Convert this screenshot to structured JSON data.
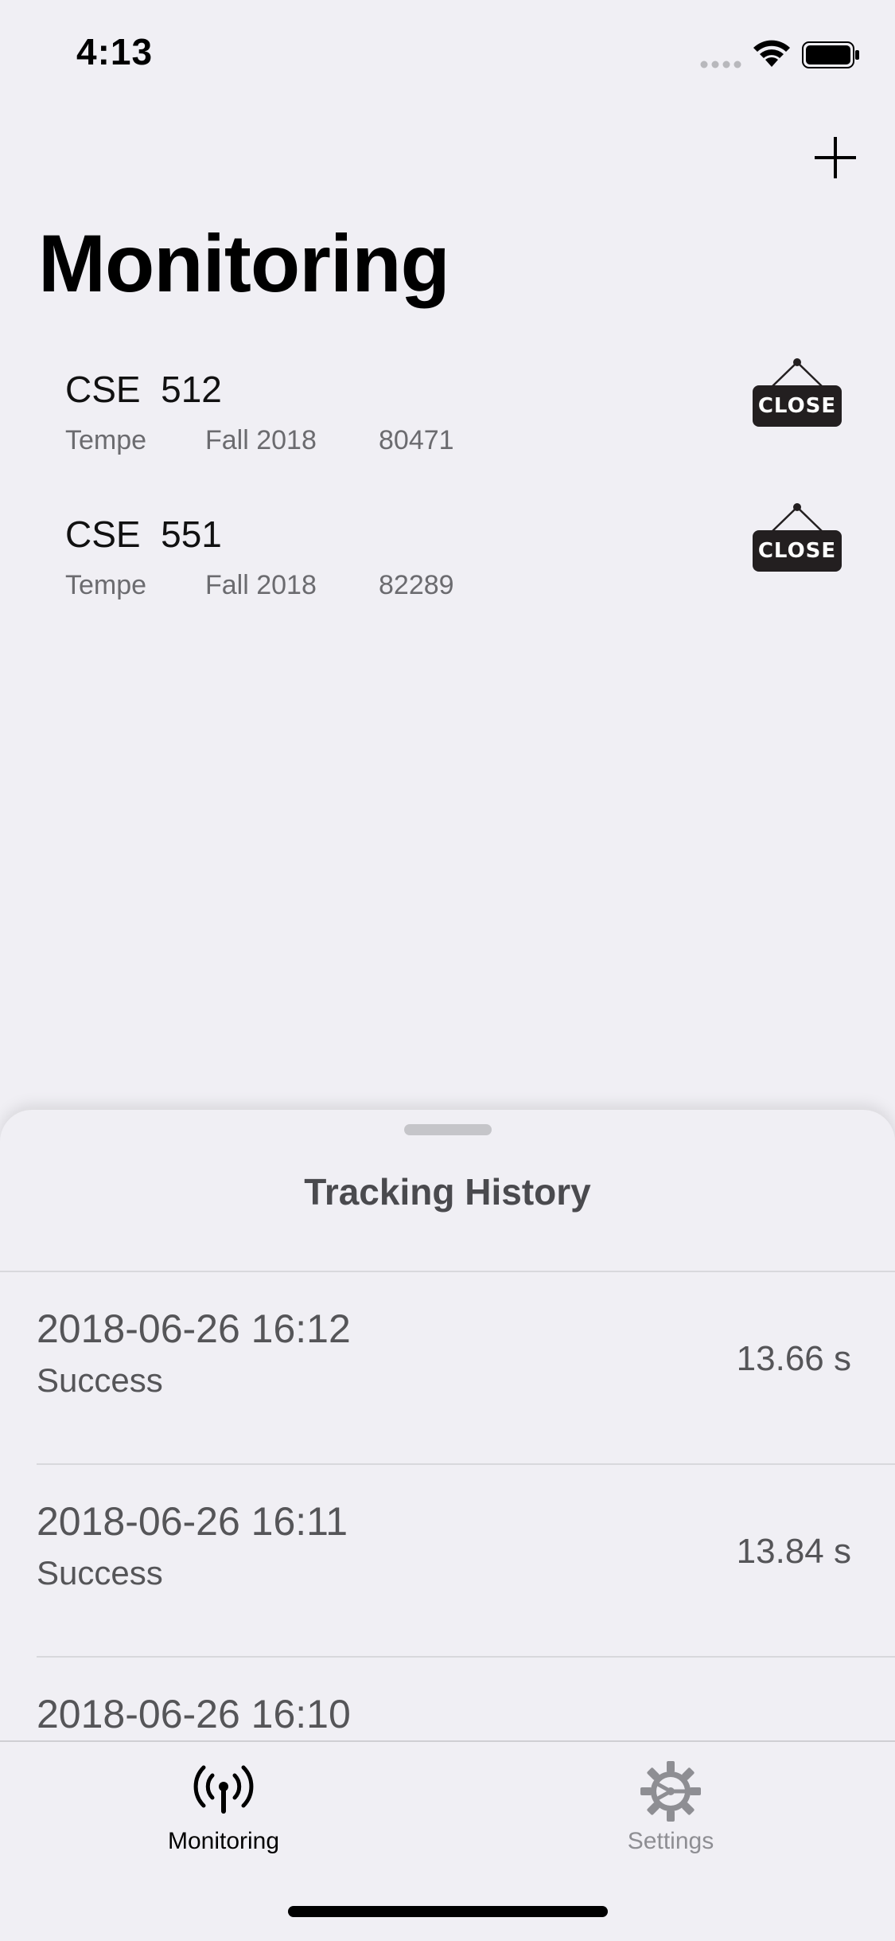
{
  "status_bar": {
    "time": "4:13",
    "signal_icon": "signal-bars-icon",
    "wifi_icon": "wifi-icon",
    "battery_icon": "battery-icon"
  },
  "nav": {
    "add_icon": "plus-icon",
    "title": "Monitoring"
  },
  "courses": [
    {
      "name": "CSE  512",
      "campus": "Tempe",
      "term": "Fall 2018",
      "class_number": "80471",
      "status_icon": "close-sign-icon",
      "status_text": "CLOSE"
    },
    {
      "name": "CSE  551",
      "campus": "Tempe",
      "term": "Fall 2018",
      "class_number": "82289",
      "status_icon": "close-sign-icon",
      "status_text": "CLOSE"
    }
  ],
  "sheet": {
    "title": "Tracking History",
    "history": [
      {
        "timestamp": "2018-06-26 16:12",
        "status": "Success",
        "duration": "13.66 s"
      },
      {
        "timestamp": "2018-06-26 16:11",
        "status": "Success",
        "duration": "13.84 s"
      },
      {
        "timestamp": "2018-06-26 16:10",
        "status": "",
        "duration": ""
      }
    ]
  },
  "tab_bar": {
    "tabs": [
      {
        "label": "Monitoring",
        "icon": "antenna-icon",
        "selected": true
      },
      {
        "label": "Settings",
        "icon": "gear-icon",
        "selected": false
      }
    ],
    "active_color": "#000000",
    "inactive_color": "#8e8e93"
  }
}
